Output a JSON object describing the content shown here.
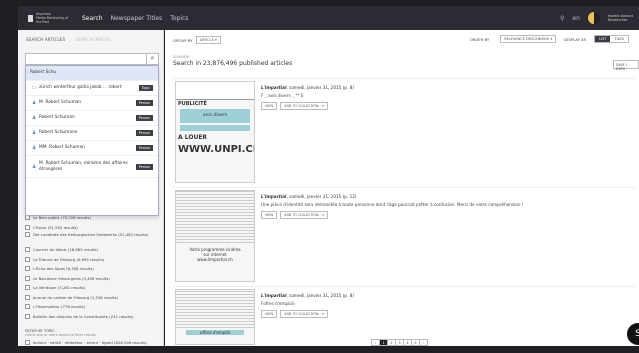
{
  "header": {
    "logo_line1": "Impresso",
    "logo_line2": "Media Monitoring of the Past",
    "nav": [
      "Search",
      "Newspaper Titles",
      "Topics"
    ],
    "lang": "en",
    "user_name": "estelle.bunout",
    "user_role": "Researcher"
  },
  "left": {
    "tab_articles": "SEARCH ARTICLES",
    "tab_images": "SEARCH IMAGES",
    "search_value": "Robert Schu",
    "suggestions": [
      {
        "label": "Robert Schu",
        "badge": ""
      },
      {
        "label": "zürich winterthur gallia jakob ... robert",
        "badge": "Topic"
      },
      {
        "label": "M. Robert Schuman",
        "badge": "Person"
      },
      {
        "label": "Robert Schuman",
        "badge": "Person"
      },
      {
        "label": "Robert Schumann",
        "badge": "Person"
      },
      {
        "label": "MM. Robert Schuman",
        "badge": "Person"
      },
      {
        "label": "M. Robert Schuman, ministre des affaires étrangères",
        "badge": "Person"
      }
    ],
    "facets": [
      "Le Bien public (70,228 results)",
      "L'Essor (51,592 results)",
      "Der Landbote des freiburgischen Seebezirks (51,482 results)",
      "Courrier du Valais (18,685 results)",
      "La Tribune de Fribourg (9,695 results)",
      "L'Écho des Alpes (6,308 results)",
      "Le Narrateur fribourgeois (3,496 results)",
      "La Véridique (3,281 results)",
      "Journal du canton de Fribourg (1,536 results)",
      "L'Observateur (778 results)",
      "Bulletin des séances de la Constituante (241 results)"
    ],
    "filter_heading": "FILTER BY TOPIC",
    "filter_sub": "check one or more topics to filter results",
    "topic_facet": "lecteur · vérité · rédacteur · erreur · égard (828,546 results)"
  },
  "main": {
    "group_by": "GROUP BY",
    "group_value": "ARTICLE ▾",
    "order_by": "ORDER BY",
    "order_value": "RELEVANCE DESCENDING ▾",
    "display_as": "DISPLAY AS",
    "display_list": "LIST",
    "display_tiles": "TILES",
    "summary_label": "SUMMARY",
    "summary_text": "Search in 23,876,496 published articles",
    "save_button": "SAVE / EXPO",
    "view_button": "VIEW",
    "add_button": "ADD TO COLLECTION... ▾",
    "articles": [
      {
        "source": "L'Impartial",
        "date": ", samedi, janvier 31, 2015 (p. 8)",
        "snippet": "F _ avis divers _ ** E"
      },
      {
        "source": "L'Impartial",
        "date": ", samedi, janvier 31, 2015 (p. 12)",
        "snippet": "Une pièce d'identité sera demandée à toute personne dont l'âge pourrait prêter à confusion. Merci de votre compréhension !"
      },
      {
        "source": "L'Impartial",
        "date": ", samedi, janvier 31, 2015 (p. 8)",
        "snippet": "Fofres d'emploi)"
      }
    ],
    "thumb1_text": [
      "PUBLICITÉ",
      "avis divers",
      "A LOUER",
      "WWW.UNPI.CH"
    ],
    "thumb2_text": [
      "Votre programme cinéma",
      "sur internet",
      "www.limpartial.ch"
    ],
    "thumb3_text": [
      "offres d'emploi"
    ],
    "pages": [
      "‹",
      "1",
      "2",
      "3",
      "4",
      "5",
      "›"
    ]
  },
  "fab_label": "S"
}
